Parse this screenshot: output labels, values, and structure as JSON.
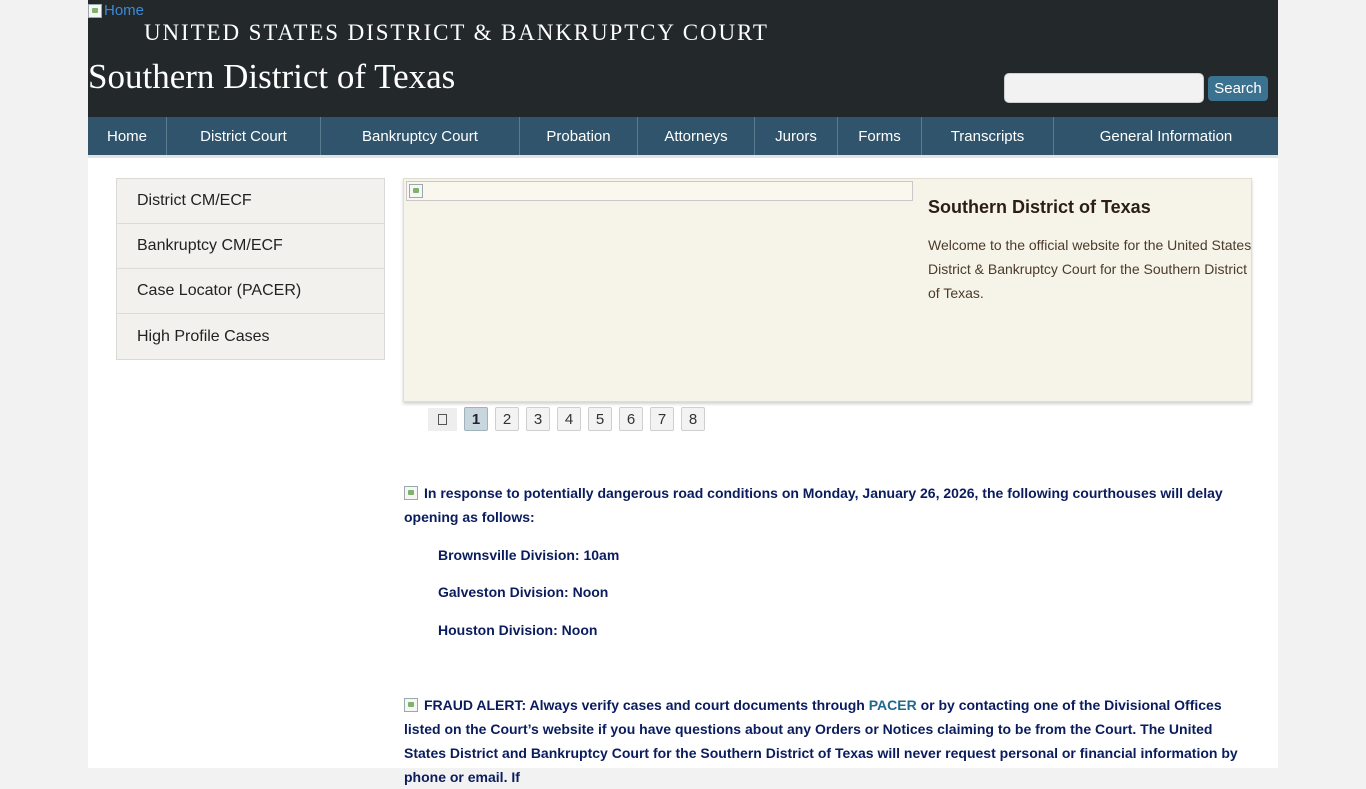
{
  "header": {
    "home_alt": "Home",
    "court_name": "UNITED STATES DISTRICT & BANKRUPTCY COURT",
    "district_name": "Southern District of Texas",
    "search_value": "",
    "search_button": "Search"
  },
  "nav": [
    {
      "label": "Home"
    },
    {
      "label": "District Court"
    },
    {
      "label": "Bankruptcy Court"
    },
    {
      "label": "Probation"
    },
    {
      "label": "Attorneys"
    },
    {
      "label": "Jurors"
    },
    {
      "label": "Forms"
    },
    {
      "label": "Transcripts"
    },
    {
      "label": "General Information"
    }
  ],
  "sidebar": [
    {
      "label": "District CM/ECF"
    },
    {
      "label": "Bankruptcy CM/ECF"
    },
    {
      "label": "Case Locator (PACER)"
    },
    {
      "label": "High Profile Cases"
    }
  ],
  "slider": {
    "title": "Southern District of Texas",
    "text": "Welcome to the official website for the United States District & Bankruptcy Court for the Southern District of Texas.",
    "pause_icon": "pause-icon",
    "pages": [
      "1",
      "2",
      "3",
      "4",
      "5",
      "6",
      "7",
      "8"
    ],
    "active_page": "1"
  },
  "notice1": {
    "text": "In response to potentially dangerous road conditions on Monday, January 26, 2026, the following courthouses will delay opening as follows:",
    "divisions": [
      "Brownsville Division: 10am",
      "Galveston Division: Noon",
      "Houston Division: Noon"
    ]
  },
  "notice2": {
    "before_link": "FRAUD ALERT: Always verify cases and court documents through ",
    "link": "PACER",
    "after_link": " or by contacting one of the Divisional Offices listed on the Court’s website if you have questions about any Orders or Notices claiming to be from the Court. The United States District and Bankruptcy Court for the Southern District of Texas will never request personal or financial information by phone or email. If"
  },
  "colors": {
    "header_bg": "#23282b",
    "nav_bg": "#2f546c",
    "search_button_bg": "#3b7290",
    "notice_text": "#0a1c5e",
    "link": "#1f6a8c"
  }
}
